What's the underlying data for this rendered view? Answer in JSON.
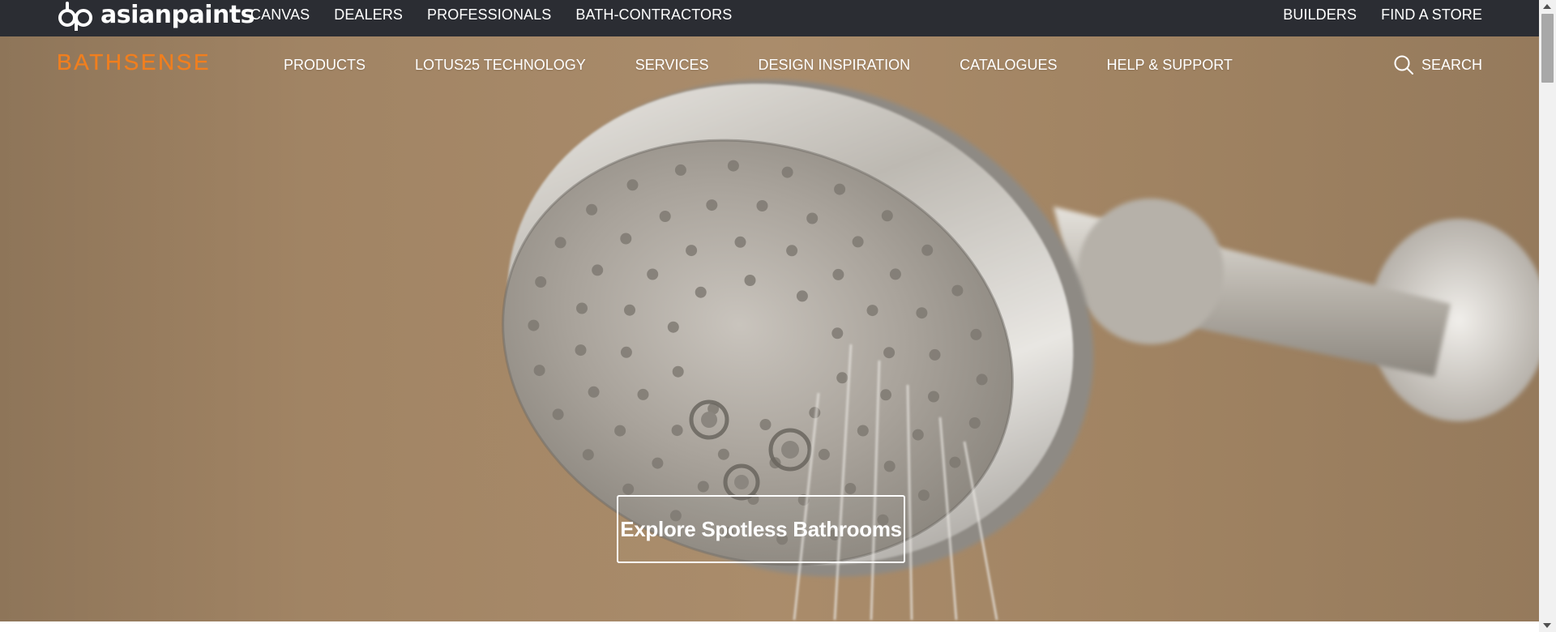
{
  "topbar": {
    "brand": "asianpaints",
    "left_links": [
      "CANVAS",
      "DEALERS",
      "PROFESSIONALS",
      "BATH-CONTRACTORS"
    ],
    "right_links": [
      "BUILDERS",
      "FIND A STORE"
    ]
  },
  "brandnav": {
    "brand": "BATHSENSE",
    "items": [
      "PRODUCTS",
      "LOTUS25 TECHNOLOGY",
      "SERVICES",
      "DESIGN INSPIRATION",
      "CATALOGUES",
      "HELP & SUPPORT"
    ],
    "search_label": "SEARCH",
    "icon": "search-icon"
  },
  "hero": {
    "cta_label": "Explore Spotless Bathrooms",
    "image_subject": "chrome shower head with water"
  },
  "colors": {
    "topbar_bg": "#2b2d33",
    "brand_orange": "#f07f1f",
    "hero_tone": "#a18464"
  }
}
